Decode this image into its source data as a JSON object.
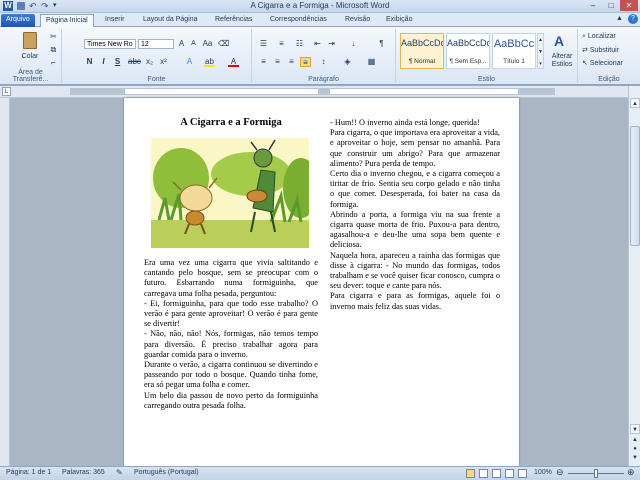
{
  "window": {
    "title": "A Cigarra e a Formiga  -  Microsoft Word"
  },
  "tabs": [
    "Arquivo",
    "Página Inicial",
    "Inserir",
    "Layout da Página",
    "Referências",
    "Correspondências",
    "Revisão",
    "Exibição"
  ],
  "ribbon": {
    "clipboard": {
      "paste_label": "Colar",
      "group_label": "Área de Transferê..."
    },
    "font": {
      "font_name": "Times New Ro",
      "font_size": "12",
      "group_label": "Fonte"
    },
    "paragraph": {
      "group_label": "Parágrafo"
    },
    "styles": {
      "items": [
        {
          "preview": "AaBbCcDc",
          "label": "¶ Normal"
        },
        {
          "preview": "AaBbCcDc",
          "label": "¶ Sem Esp..."
        },
        {
          "preview": "AaBbCc",
          "label": "Título 1"
        }
      ],
      "change_styles": "Alterar Estilos",
      "group_label": "Estilo"
    },
    "editing": {
      "find": "Localizar",
      "replace": "Substituir",
      "select": "Selecionar",
      "group_label": "Edição"
    }
  },
  "document": {
    "title": "A Cigarra e a Formiga",
    "col1": [
      "Era uma vez uma cigarra que vivia saltitando e cantando pelo bosque, sem se preocupar com o futuro. Esbarrando numa formiguinha, que carregava uma folha pesada, perguntou:",
      "- Ei, formiguinha, para que todo esse trabalho? O verão é para gente aproveitar! O verão é para gente se divertir!",
      "- Não, não, não! Nós, formigas, não temos tempo para diversão. É preciso trabalhar agora para guardar comida para o inverno.",
      "Durante o verão, a cigarra continuou se divertindo e passeando por todo o bosque. Quando tinha fome, era só pegar uma folha e comer.",
      "Um belo dia passou de novo perto da formiguinha carregando outra pesada folha."
    ],
    "col2": [
      "- Hum!! O inverno ainda está longe, querida!",
      "Para cigarra, o que importava era aproveitar a vida, e aproveitar o hoje, sem pensar no amanhã. Para que construir um abrigo? Para que armazenar alimento? Pura perda de tempo.",
      "Certo dia o inverno chegou, e a cigarra começou a tiritar de frio. Sentia seu corpo gelado e não tinha o que comer. Desesperada, foi bater na casa da formiga.",
      "Abrindo a porta, a formiga viu na sua frente a cigarra quase morta de frio. Puxou-a para dentro, agasalhou-a e deu-lhe uma sopa bem quente e deliciosa.",
      "Naquela hora, apareceu a rainha das formigas que disse à cigarra: - No mundo das formigas, todos trabalham e se você quiser ficar conosco, cumpra o seu dever: toque e cante para nós.",
      "Para cigarra e para as formigas, aquele foi o inverno mais feliz das suas vidas."
    ]
  },
  "status": {
    "page": "Página: 1 de 1",
    "words": "Palavras: 365",
    "language": "Português (Portugal)",
    "zoom": "100%"
  },
  "colors": {
    "accent": "#2b579a",
    "file_tab": "#1d57b0",
    "ribbon_bg": "#dbe6f4"
  }
}
